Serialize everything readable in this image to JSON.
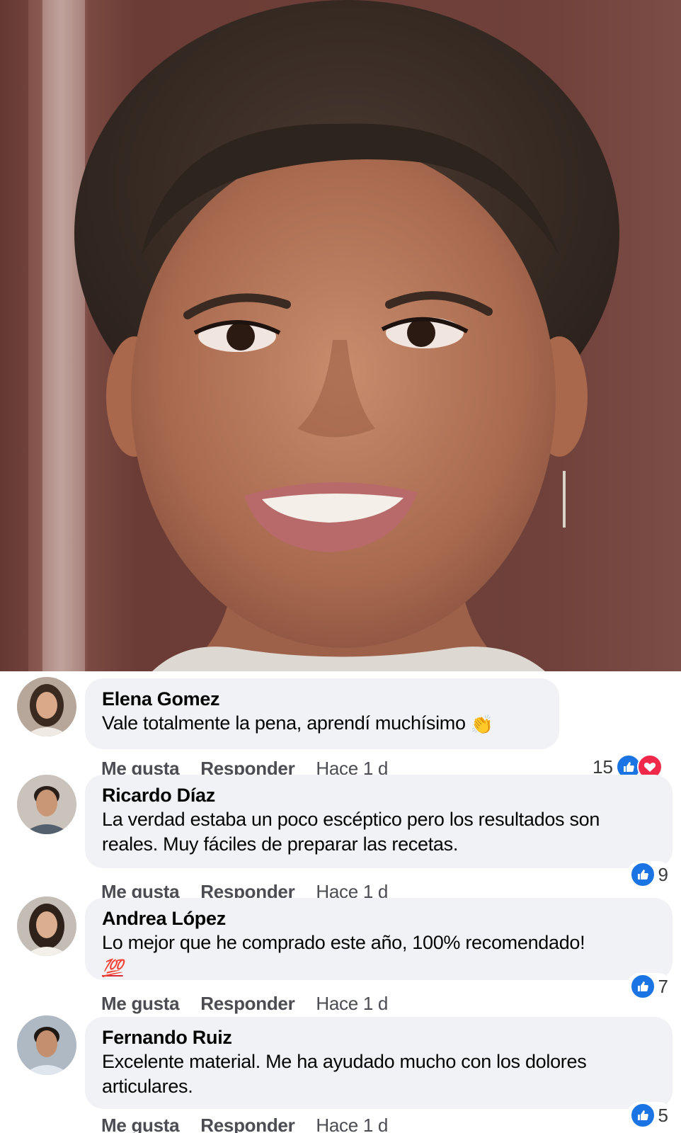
{
  "post_photo": {
    "alt_name": "portrait-photo"
  },
  "comments": [
    {
      "author": "Elena Gomez",
      "text": "Vale totalmente la pena, aprendí muchísimo",
      "emoji": "👏",
      "like_label": "Me gusta",
      "reply_label": "Responder",
      "time": "Hace 1 d",
      "reaction_count": "15",
      "reactions": [
        "like",
        "love"
      ],
      "avatar": "woman-avatar"
    },
    {
      "author": "Ricardo Díaz",
      "text": "La verdad estaba un poco escéptico pero los resultados son reales. Muy fáciles de preparar las recetas.",
      "emoji": "",
      "like_label": "Me gusta",
      "reply_label": "Responder",
      "time": "Hace 1 d",
      "reaction_count": "9",
      "reactions": [
        "like"
      ],
      "avatar": "man-avatar"
    },
    {
      "author": "Andrea López",
      "text": "Lo mejor que he comprado este año, 100% recomendado!",
      "emoji": "💯",
      "like_label": "Me gusta",
      "reply_label": "Responder",
      "time": "Hace 1 d",
      "reaction_count": "7",
      "reactions": [
        "like"
      ],
      "avatar": "woman-avatar"
    },
    {
      "author": "Fernando Ruiz",
      "text": "Excelente material. Me ha ayudado mucho con los dolores articulares.",
      "emoji": "",
      "like_label": "Me gusta",
      "reply_label": "Responder",
      "time": "Hace 1 d",
      "reaction_count": "5",
      "reactions": [
        "like"
      ],
      "avatar": "man-avatar"
    }
  ],
  "colors": {
    "bubble": "#f0f2f5",
    "like_blue": "#1b74e4",
    "love_red": "#f02849",
    "meta_gray": "#4b4d52"
  }
}
